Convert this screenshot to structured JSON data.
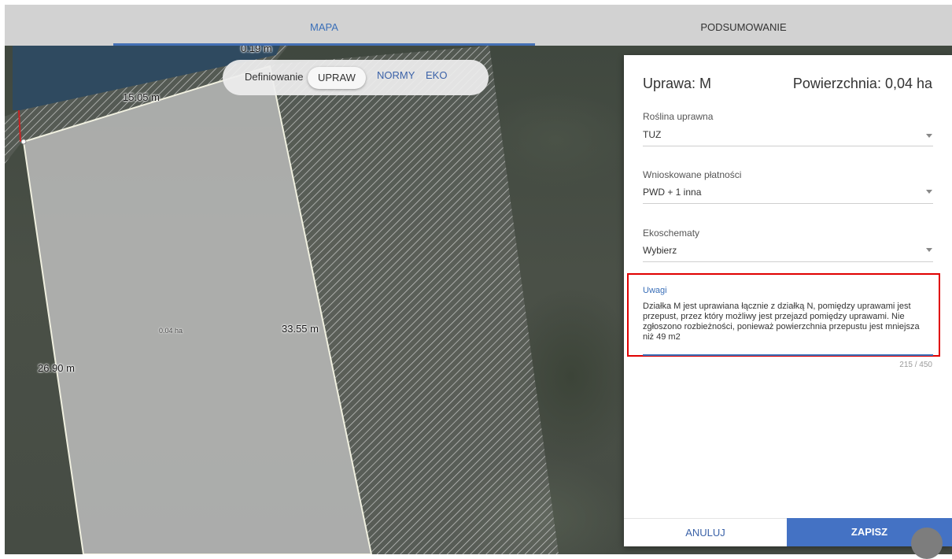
{
  "tabs": [
    {
      "label": "MAPA",
      "active": true
    },
    {
      "label": "PODSUMOWANIE",
      "active": false
    }
  ],
  "map": {
    "dimensions": {
      "top_cut": "0.19 m",
      "top_edge": "15.05 m",
      "right_edge": "33.55 m",
      "left_edge": "26.90 m"
    },
    "area_label": "0.04 ha"
  },
  "define_bar": {
    "label": "Definiowanie",
    "options": [
      "UPRAW",
      "NORMY",
      "EKO"
    ],
    "selected": "UPRAW"
  },
  "panel": {
    "title": "Uprawa: M",
    "area": "Powierzchnia: 0,04 ha",
    "fields": [
      {
        "label": "Roślina uprawna",
        "value": "TUZ"
      },
      {
        "label": "Wnioskowane płatności",
        "value": "PWD + 1 inna"
      },
      {
        "label": "Ekoschematy",
        "value": "Wybierz"
      }
    ],
    "notes": {
      "label": "Uwagi",
      "value": "Działka M jest uprawiana łącznie z działką N, pomiędzy uprawami jest przepust, przez który możliwy jest przejazd pomiędzy uprawami. Nie zgłoszono rozbieżności, ponieważ powierzchnia przepustu jest mniejsza niż 49 m2",
      "counter": "215 / 450"
    },
    "buttons": {
      "cancel": "ANULUJ",
      "save": "ZAPISZ"
    }
  },
  "colors": {
    "accent": "#4472c4",
    "highlight_border": "#e00000"
  }
}
